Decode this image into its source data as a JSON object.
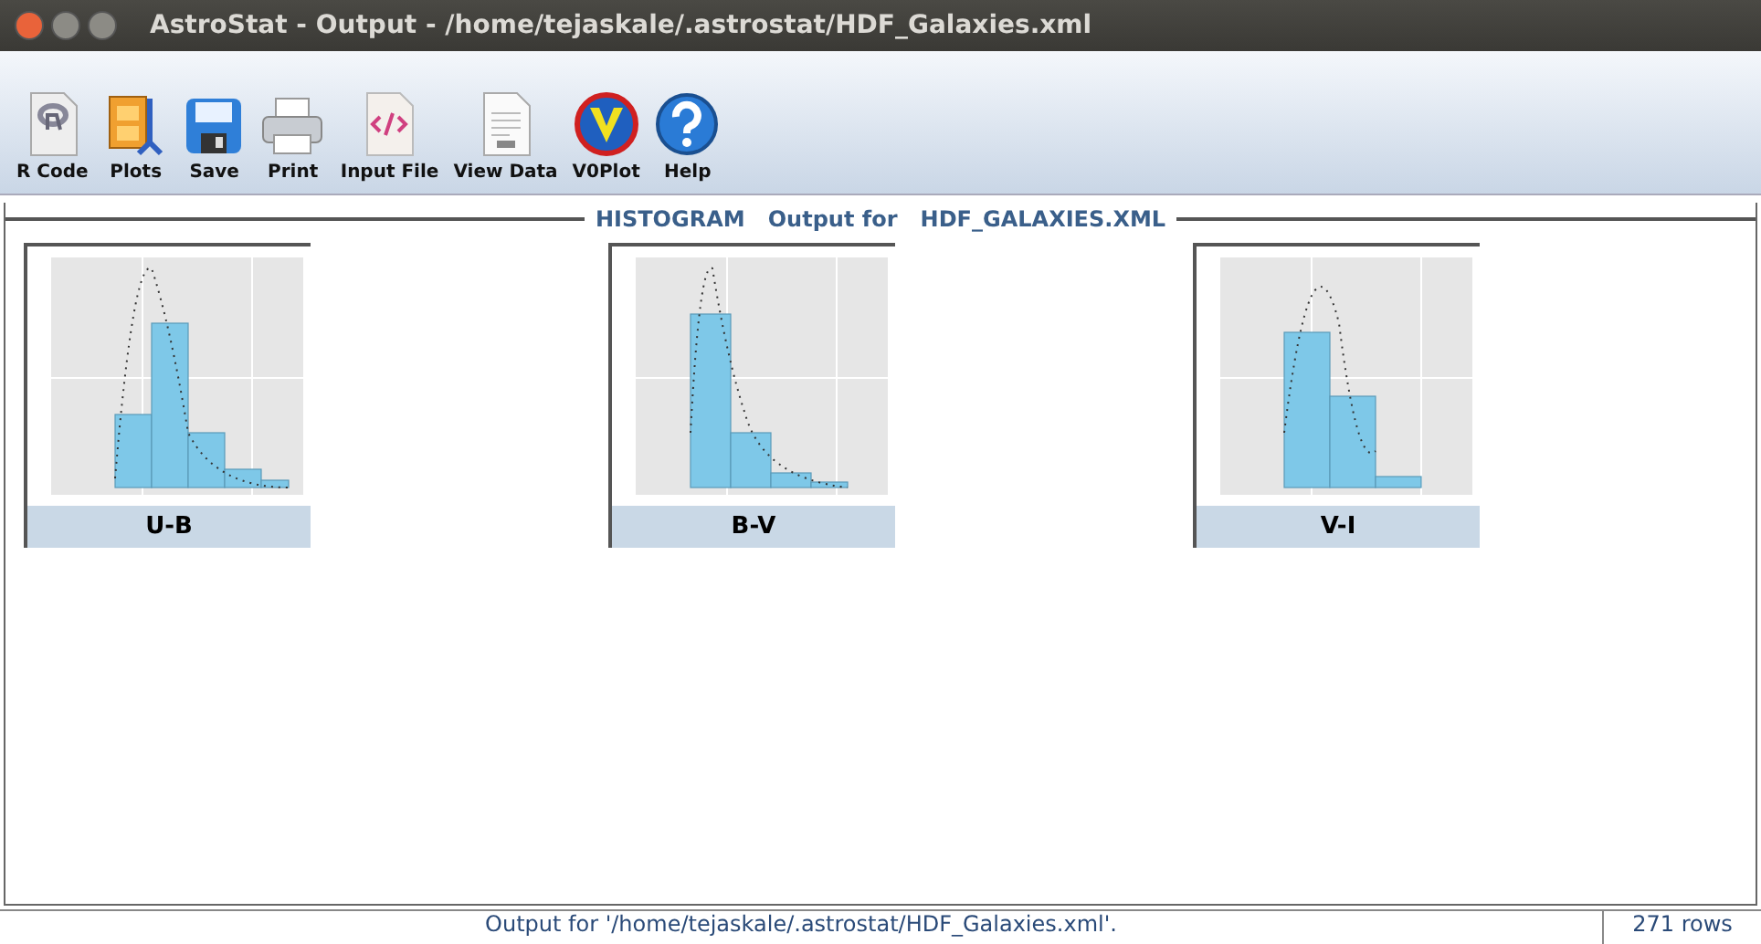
{
  "window": {
    "title": "AstroStat - Output - /home/tejaskale/.astrostat/HDF_Galaxies.xml"
  },
  "toolbar": [
    {
      "kind": "rcode",
      "label": "R Code"
    },
    {
      "kind": "plots",
      "label": "Plots"
    },
    {
      "kind": "save",
      "label": "Save"
    },
    {
      "kind": "print",
      "label": "Print"
    },
    {
      "kind": "input",
      "label": "Input File"
    },
    {
      "kind": "data",
      "label": "View Data"
    },
    {
      "kind": "voplot",
      "label": "V0Plot"
    },
    {
      "kind": "help",
      "label": "Help"
    }
  ],
  "panel": {
    "title": "HISTOGRAM   Output for   HDF_GALAXIES.XML",
    "plots": [
      {
        "kind": "picture",
        "label": "U-B"
      },
      {
        "kind": "picture",
        "label": "B-V"
      },
      {
        "kind": "picture",
        "label": "V-I"
      }
    ]
  },
  "status_bar": {
    "message": "Output for '/home/tejaskale/.astrostat/HDF_Galaxies.xml'.",
    "rows": "271 rows"
  }
}
